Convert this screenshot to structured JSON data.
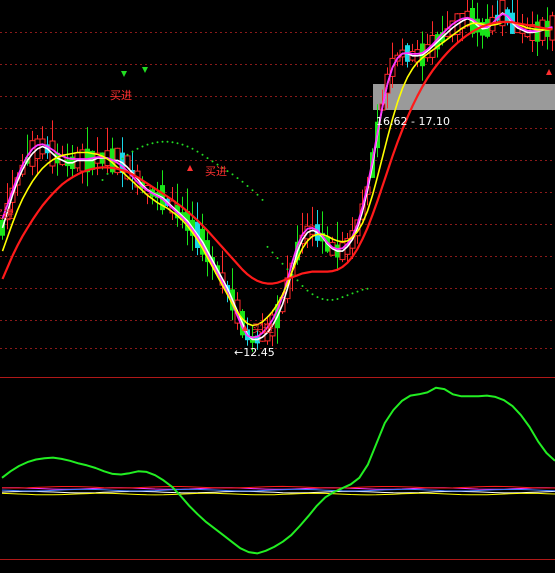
{
  "colors": {
    "background": "#000000",
    "grid": "#8a1a1a",
    "panel_border": "#b01818",
    "up_candle": "#ff2a2a",
    "down_candle_green": "#19e619",
    "down_candle_cyan": "#19d8e6",
    "ma_white": "#ffffff",
    "ma_magenta": "#ff33ff",
    "ma_yellow": "#ffff00",
    "ma_red": "#ff1a1a",
    "signal_dots": "#22dd22",
    "indicator_green": "#22ee22",
    "buy_label": "#ff3030",
    "price_label": "#ffffff",
    "highlight_band": "#9a9a9a"
  },
  "chart_data": [
    {
      "type": "line",
      "panel": "main",
      "x": [
        1,
        2,
        3,
        4,
        5,
        6,
        7,
        8,
        9,
        10,
        11,
        12,
        13,
        14,
        15,
        16,
        17,
        18,
        19,
        20,
        21,
        22,
        23,
        24,
        25,
        26,
        27,
        28,
        29,
        30,
        31,
        32,
        33,
        34,
        35,
        36,
        37,
        38,
        39,
        40,
        41,
        42,
        43,
        44,
        45,
        46,
        47,
        48,
        49,
        50,
        51,
        52,
        53,
        54,
        55,
        56,
        57,
        58,
        59,
        60,
        61,
        62,
        63,
        64,
        65,
        66,
        67,
        68,
        69,
        70,
        71,
        72,
        73,
        74,
        75,
        76,
        77,
        78,
        79,
        80,
        81,
        82,
        83,
        84,
        85,
        86,
        87,
        88,
        89,
        90,
        91,
        92,
        93,
        94,
        95,
        96,
        97,
        98,
        99,
        100,
        101,
        102,
        103,
        104,
        105,
        106,
        107,
        108,
        109,
        110,
        111
      ],
      "series": [
        {
          "key": "ma_short",
          "color": "#ffffff",
          "values": [
            15.1,
            15.45,
            15.8,
            16.1,
            16.35,
            16.55,
            16.7,
            16.8,
            16.85,
            16.8,
            16.7,
            16.6,
            16.55,
            16.5,
            16.5,
            16.55,
            16.55,
            16.55,
            16.55,
            16.6,
            16.6,
            16.6,
            16.55,
            16.55,
            16.5,
            16.4,
            16.28,
            16.15,
            16.02,
            15.92,
            15.85,
            15.8,
            15.75,
            15.65,
            15.55,
            15.45,
            15.35,
            15.25,
            15.1,
            14.95,
            14.8,
            14.6,
            14.4,
            14.2,
            14.0,
            13.8,
            13.55,
            13.3,
            13.05,
            12.8,
            12.7,
            12.7,
            12.75,
            12.85,
            13.0,
            13.2,
            13.45,
            13.8,
            14.2,
            14.6,
            14.85,
            15.0,
            15.05,
            15.0,
            14.9,
            14.75,
            14.65,
            14.6,
            14.6,
            14.7,
            14.85,
            15.1,
            15.45,
            15.9,
            16.45,
            17.1,
            17.7,
            18.2,
            18.55,
            18.75,
            18.85,
            18.85,
            18.8,
            18.8,
            18.82,
            18.9,
            19.0,
            19.1,
            19.2,
            19.3,
            19.4,
            19.48,
            19.55,
            19.6,
            19.55,
            19.45,
            19.38,
            19.4,
            19.48,
            19.62,
            19.72,
            19.65,
            19.5,
            19.4,
            19.35,
            19.3,
            19.3,
            19.32,
            19.35,
            19.38,
            19.4
          ]
        },
        {
          "key": "ma_mid",
          "color": "#ff33ff",
          "values": [
            15.3,
            15.6,
            15.9,
            16.2,
            16.45,
            16.65,
            16.8,
            16.88,
            16.9,
            16.85,
            16.78,
            16.7,
            16.64,
            16.6,
            16.58,
            16.58,
            16.58,
            16.58,
            16.6,
            16.62,
            16.62,
            16.6,
            16.56,
            16.5,
            16.42,
            16.32,
            16.2,
            16.08,
            15.98,
            15.9,
            15.84,
            15.78,
            15.72,
            15.62,
            15.52,
            15.42,
            15.32,
            15.2,
            15.06,
            14.9,
            14.72,
            14.52,
            14.32,
            14.12,
            13.92,
            13.7,
            13.46,
            13.2,
            12.95,
            12.78,
            12.74,
            12.76,
            12.84,
            12.96,
            13.12,
            13.34,
            13.62,
            13.98,
            14.38,
            14.72,
            14.96,
            15.08,
            15.1,
            15.04,
            14.92,
            14.78,
            14.68,
            14.64,
            14.66,
            14.76,
            14.92,
            15.18,
            15.55,
            16.0,
            16.55,
            17.15,
            17.72,
            18.2,
            18.55,
            18.75,
            18.85,
            18.86,
            18.84,
            18.84,
            18.86,
            18.94,
            19.04,
            19.16,
            19.28,
            19.38,
            19.48,
            19.55,
            19.6,
            19.62,
            19.58,
            19.5,
            19.42,
            19.42,
            19.5,
            19.62,
            19.7,
            19.66,
            19.54,
            19.44,
            19.38,
            19.34,
            19.33,
            19.34,
            19.36,
            19.39,
            19.42
          ]
        },
        {
          "key": "ma_long",
          "color": "#ffff00",
          "values": [
            14.6,
            14.9,
            15.2,
            15.48,
            15.72,
            15.92,
            16.1,
            16.25,
            16.38,
            16.48,
            16.56,
            16.62,
            16.66,
            16.68,
            16.7,
            16.72,
            16.72,
            16.72,
            16.7,
            16.68,
            16.64,
            16.58,
            16.5,
            16.4,
            16.3,
            16.2,
            16.1,
            16.0,
            15.9,
            15.8,
            15.72,
            15.64,
            15.58,
            15.52,
            15.44,
            15.36,
            15.26,
            15.14,
            15.0,
            14.84,
            14.66,
            14.46,
            14.26,
            14.06,
            13.86,
            13.66,
            13.46,
            13.28,
            13.14,
            13.04,
            13.0,
            13.02,
            13.08,
            13.18,
            13.3,
            13.46,
            13.66,
            13.9,
            14.18,
            14.44,
            14.66,
            14.82,
            14.92,
            14.96,
            14.96,
            14.92,
            14.86,
            14.82,
            14.8,
            14.82,
            14.9,
            15.02,
            15.2,
            15.46,
            15.8,
            16.2,
            16.62,
            17.04,
            17.44,
            17.8,
            18.1,
            18.34,
            18.52,
            18.66,
            18.76,
            18.84,
            18.92,
            19.0,
            19.08,
            19.16,
            19.24,
            19.32,
            19.4,
            19.46,
            19.5,
            19.5,
            19.48,
            19.46,
            19.46,
            19.48,
            19.52,
            19.54,
            19.52,
            19.48,
            19.44,
            19.4,
            19.38,
            19.36,
            19.36,
            19.36,
            19.37
          ]
        },
        {
          "key": "ma_trend",
          "color": "#ff1a1a",
          "values": [
            14.0,
            14.25,
            14.5,
            14.72,
            14.92,
            15.1,
            15.27,
            15.43,
            15.58,
            15.71,
            15.83,
            15.94,
            16.04,
            16.12,
            16.19,
            16.25,
            16.3,
            16.34,
            16.37,
            16.39,
            16.4,
            16.4,
            16.39,
            16.37,
            16.34,
            16.3,
            16.25,
            16.19,
            16.12,
            16.05,
            15.98,
            15.91,
            15.84,
            15.77,
            15.7,
            15.62,
            15.54,
            15.45,
            15.36,
            15.26,
            15.15,
            15.04,
            14.92,
            14.8,
            14.68,
            14.56,
            14.44,
            14.32,
            14.2,
            14.1,
            14.02,
            13.96,
            13.92,
            13.9,
            13.9,
            13.92,
            13.96,
            14.0,
            14.04,
            14.08,
            14.12,
            14.14,
            14.16,
            14.16,
            14.16,
            14.16,
            14.17,
            14.2,
            14.26,
            14.35,
            14.48,
            14.65,
            14.86,
            15.1,
            15.38,
            15.68,
            16.0,
            16.32,
            16.64,
            16.94,
            17.22,
            17.48,
            17.72,
            17.94,
            18.14,
            18.32,
            18.48,
            18.62,
            18.75,
            18.87,
            18.98,
            19.08,
            19.17,
            19.25,
            19.32,
            19.38,
            19.43,
            19.47,
            19.5,
            19.52,
            19.53,
            19.53,
            19.52,
            19.5,
            19.48,
            19.46,
            19.44,
            19.42,
            19.4,
            19.38,
            19.37
          ]
        }
      ],
      "ylim": [
        12.0,
        20.0
      ],
      "annotations": {
        "low_price_label": "←12.45",
        "low_price_value": 12.45,
        "range_label": "16.62 - 17.10",
        "range_value_low": 16.62,
        "range_value_high": 17.1,
        "buy_signal_text": "买进"
      }
    },
    {
      "type": "line",
      "panel": "indicator",
      "series": [
        {
          "key": "oscillator",
          "color": "#22ee22",
          "values": [
            2.0,
            3.0,
            3.8,
            4.4,
            4.8,
            5.0,
            5.1,
            4.9,
            4.6,
            4.2,
            3.9,
            3.5,
            3.0,
            2.6,
            2.5,
            2.7,
            3.0,
            2.9,
            2.4,
            1.6,
            0.6,
            -0.8,
            -2.3,
            -3.6,
            -4.8,
            -5.8,
            -6.8,
            -7.8,
            -8.8,
            -9.4,
            -9.6,
            -9.2,
            -8.6,
            -7.8,
            -6.8,
            -5.4,
            -3.9,
            -2.3,
            -1.0,
            -0.2,
            0.4,
            1.0,
            2.0,
            4.0,
            7.2,
            10.4,
            12.4,
            13.8,
            14.6,
            14.8,
            15.1,
            15.8,
            15.6,
            14.8,
            14.5,
            14.5,
            14.5,
            14.6,
            14.4,
            13.9,
            13.0,
            11.6,
            9.8,
            7.6,
            5.8,
            4.6
          ]
        }
      ],
      "ylim": [
        -10,
        17
      ]
    }
  ]
}
